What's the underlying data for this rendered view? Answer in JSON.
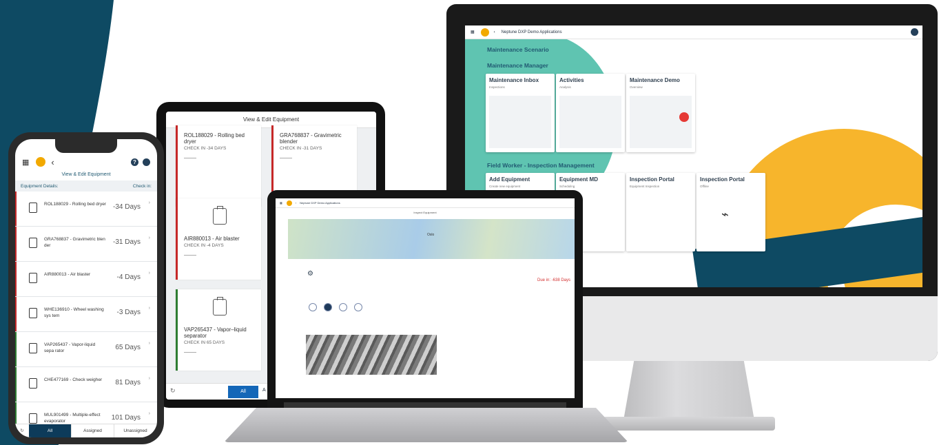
{
  "monitor": {
    "app_title": "Neptune DXP Demo Applications",
    "section_scenario": "Maintenance Scenario",
    "section_manager": "Maintenance Manager",
    "section_field": "Field Worker - Inspection Management",
    "tiles_manager": [
      {
        "title": "Maintenance Inbox",
        "subtitle": "Inspections"
      },
      {
        "title": "Activities",
        "subtitle": "Analysis"
      },
      {
        "title": "Maintenance Demo",
        "subtitle": "Overview"
      }
    ],
    "tiles_field": [
      {
        "title": "Add Equipment",
        "subtitle": "Create new equipment"
      },
      {
        "title": "Equipment MD",
        "subtitle": "Scheduling"
      },
      {
        "title": "Inspection Portal",
        "subtitle": "Equipment Inspection"
      },
      {
        "title": "Inspection Portal",
        "subtitle": "Offline"
      }
    ]
  },
  "tablet": {
    "title": "View & Edit Equipment",
    "cards": [
      {
        "name": "ROL188029 - Rolling bed dryer",
        "status": "CHECK IN -34 DAYS",
        "color": "#c62828"
      },
      {
        "name": "GRA768837 - Gravimetric blender",
        "status": "CHECK IN -31 DAYS",
        "color": "#c62828"
      },
      {
        "name": "AIR880013 - Air blaster",
        "status": "CHECK IN -4 DAYS",
        "color": "#c62828"
      },
      {
        "name": "VAP265437 - Vapor–liquid separator",
        "status": "CHECK IN 65 DAYS",
        "color": "#2e7d32"
      }
    ],
    "filter_all": "All",
    "filter_partial": "A"
  },
  "laptop": {
    "app_title": "Neptune DXP Demo Applications",
    "page_title": "Inspect Equipment",
    "map_label": "Oslo",
    "due": "Due in: -638 Days"
  },
  "phone": {
    "title": "View & Edit Equipment",
    "col_left": "Equipment Details:",
    "col_right": "Check in:",
    "rows": [
      {
        "text": "ROL188029 - Rolling bed dryer",
        "days": "-34 Days",
        "color": "#c62828"
      },
      {
        "text": "GRA768837 - Gravimetric blen der",
        "days": "-31 Days",
        "color": "#c62828"
      },
      {
        "text": "AIR880013 - Air blaster",
        "days": "-4 Days",
        "color": "#c62828"
      },
      {
        "text": "WHE136910 - Wheel washing sys tem",
        "days": "-3 Days",
        "color": "#c62828"
      },
      {
        "text": "VAP265437 - Vapor-liquid sepa rator",
        "days": "65 Days",
        "color": "#2e7d32"
      },
      {
        "text": "CHE477169 - Check weigher",
        "days": "81 Days",
        "color": "#2e7d32"
      },
      {
        "text": "MUL901499 - Multiple-effect evaporator",
        "days": "101 Days",
        "color": "#2e7d32"
      }
    ],
    "tabs": [
      "All",
      "Assigned",
      "Unassigned"
    ]
  },
  "colors": {
    "navy": "#0e4a63",
    "teal": "#5fc4b1",
    "orange": "#f7b52c"
  }
}
